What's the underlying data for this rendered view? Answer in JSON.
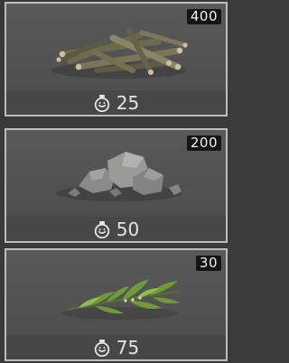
{
  "items": [
    {
      "name": "Firewood",
      "count": "400",
      "cost": "25",
      "art_icon": "wood-pile-icon"
    },
    {
      "name": "Stone",
      "count": "200",
      "cost": "50",
      "art_icon": "stone-pile-icon"
    },
    {
      "name": "Leaves",
      "count": "30",
      "cost": "75",
      "art_icon": "leaf-branch-icon"
    }
  ],
  "cost_icon": "stamina-icon",
  "colors": {
    "card_border": "#bdbdbd",
    "count_bg": "#151515",
    "text": "#e4e4e4"
  }
}
